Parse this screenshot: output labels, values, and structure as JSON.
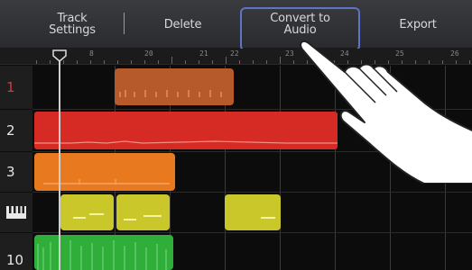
{
  "toolbar": {
    "track_settings": "Track\nSettings",
    "delete": "Delete",
    "convert_to_audio": "Convert to\nAudio",
    "export": "Export"
  },
  "ruler": {
    "labels": [
      "8",
      "20",
      "21",
      "22",
      "23",
      "24",
      "25",
      "26"
    ]
  },
  "tracks": [
    {
      "label": "1"
    },
    {
      "label": "2"
    },
    {
      "label": "3"
    },
    {
      "label": ""
    },
    {
      "label": "10"
    }
  ],
  "icons": {
    "piano_track": "piano-keyboard-icon",
    "pointer": "pointing-hand-icon"
  },
  "colors": {
    "track1": "#b65a2c",
    "track2": "#d62a24",
    "track3": "#e8791e",
    "track4": "#c9c72a",
    "track5": "#2fae3a",
    "highlight": "#5d74c8"
  }
}
